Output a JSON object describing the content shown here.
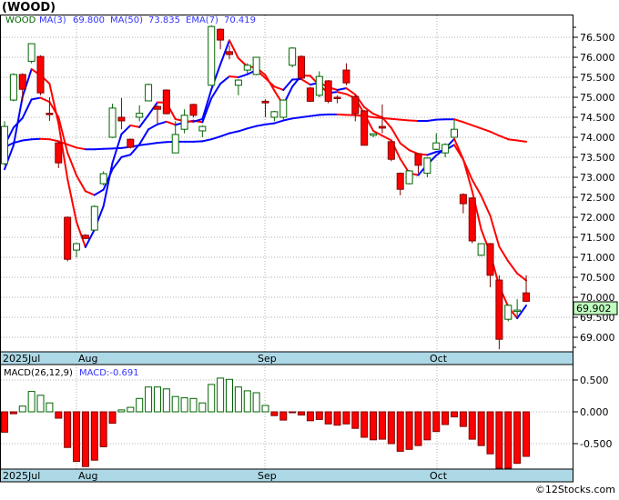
{
  "header": {
    "title": "(WOOD)"
  },
  "legend": {
    "symbol": "WOOD",
    "ma3_label": "MA(3)",
    "ma3_value": "69.800",
    "ma50_label": "MA(50)",
    "ma50_value": "73.835",
    "ema7_label": "EMA(7)",
    "ema7_value": "70.419"
  },
  "macd_legend": {
    "label": "MACD(26,12,9)",
    "value": "MACD:-0.691"
  },
  "last_price": "69.902",
  "footer": "©12Stocks.com",
  "colors": {
    "up": "#006400",
    "down": "#ff0000",
    "rising_line": "#0000ff",
    "falling_line": "#ff0000",
    "axis_strip": "#add8e6",
    "last_price_bg": "#c0ffc0"
  },
  "chart_data": [
    {
      "type": "candlestick",
      "ylim": [
        68.7,
        76.9
      ],
      "y_ticks": [
        "76.500",
        "76.000",
        "75.500",
        "75.000",
        "74.500",
        "74.000",
        "73.500",
        "73.000",
        "72.500",
        "72.000",
        "71.500",
        "71.000",
        "70.500",
        "70.000",
        "69.500",
        "69.000"
      ],
      "x_labels": [
        "2025Jul",
        "Aug",
        "Sep",
        "Oct"
      ],
      "grid": true,
      "ohlc": [
        [
          73.34,
          74.4,
          73.3,
          74.27
        ],
        [
          74.93,
          75.6,
          74.9,
          75.57
        ],
        [
          75.57,
          75.6,
          74.9,
          75.2
        ],
        [
          75.9,
          76.35,
          75.85,
          76.34
        ],
        [
          76.02,
          76.05,
          75.05,
          75.11
        ],
        [
          74.6,
          75.0,
          74.41,
          74.57
        ],
        [
          73.86,
          73.9,
          73.23,
          73.36
        ],
        [
          72.0,
          72.02,
          70.9,
          70.95
        ],
        [
          71.18,
          71.36,
          71.0,
          71.34
        ],
        [
          71.55,
          71.58,
          71.45,
          71.47
        ],
        [
          71.68,
          72.3,
          71.65,
          72.27
        ],
        [
          72.84,
          73.15,
          72.8,
          73.09
        ],
        [
          74.0,
          74.84,
          73.98,
          74.73
        ],
        [
          74.5,
          74.98,
          74.2,
          74.41
        ],
        [
          73.95,
          73.97,
          73.72,
          73.75
        ],
        [
          74.5,
          74.8,
          74.4,
          74.6
        ],
        [
          74.91,
          75.34,
          74.9,
          75.32
        ],
        [
          74.77,
          74.8,
          74.35,
          74.7
        ],
        [
          75.18,
          75.2,
          74.57,
          74.59
        ],
        [
          73.61,
          74.4,
          73.6,
          74.07
        ],
        [
          74.2,
          74.7,
          74.1,
          74.55
        ],
        [
          74.82,
          74.84,
          74.5,
          74.55
        ],
        [
          74.16,
          74.3,
          74.0,
          74.27
        ],
        [
          75.3,
          76.8,
          75.28,
          76.77
        ],
        [
          76.7,
          76.72,
          76.2,
          76.43
        ],
        [
          76.14,
          76.3,
          75.95,
          76.07
        ],
        [
          75.3,
          75.45,
          75.05,
          75.43
        ],
        [
          75.68,
          75.85,
          75.6,
          75.8
        ],
        [
          75.57,
          76.0,
          75.55,
          76.0
        ],
        [
          74.9,
          74.95,
          74.5,
          74.86
        ],
        [
          74.5,
          74.66,
          74.4,
          74.64
        ],
        [
          74.5,
          74.95,
          74.45,
          74.93
        ],
        [
          75.8,
          76.25,
          75.75,
          76.23
        ],
        [
          76.02,
          76.05,
          75.45,
          75.48
        ],
        [
          75.23,
          75.26,
          74.88,
          74.9
        ],
        [
          75.05,
          75.65,
          75.0,
          75.52
        ],
        [
          75.41,
          75.43,
          74.85,
          74.9
        ],
        [
          75.0,
          75.05,
          74.85,
          74.98
        ],
        [
          75.68,
          75.85,
          75.3,
          75.36
        ],
        [
          75.02,
          75.05,
          74.4,
          74.59
        ],
        [
          74.66,
          74.68,
          73.8,
          73.8
        ],
        [
          74.05,
          74.1,
          74.0,
          74.09
        ],
        [
          74.27,
          74.82,
          74.1,
          74.23
        ],
        [
          73.89,
          73.9,
          73.4,
          73.45
        ],
        [
          73.1,
          73.12,
          72.55,
          72.7
        ],
        [
          72.84,
          73.18,
          72.82,
          73.16
        ],
        [
          73.59,
          73.6,
          73.1,
          73.3
        ],
        [
          73.1,
          73.5,
          73.0,
          73.48
        ],
        [
          73.7,
          74.1,
          73.68,
          73.86
        ],
        [
          73.61,
          73.85,
          73.5,
          73.82
        ],
        [
          74.0,
          74.43,
          73.98,
          74.2
        ],
        [
          72.57,
          72.6,
          72.1,
          72.34
        ],
        [
          72.48,
          72.5,
          71.35,
          71.41
        ],
        [
          71.05,
          71.35,
          71.03,
          71.34
        ],
        [
          71.34,
          71.36,
          70.25,
          70.55
        ],
        [
          70.43,
          70.55,
          68.7,
          68.95
        ],
        [
          69.45,
          69.82,
          69.4,
          69.8
        ],
        [
          69.68,
          69.95,
          69.5,
          69.68
        ],
        [
          70.11,
          70.55,
          69.88,
          69.9
        ]
      ],
      "ma50": [
        73.75,
        73.86,
        73.92,
        73.95,
        73.96,
        73.95,
        73.9,
        73.82,
        73.74,
        73.7,
        73.7,
        73.71,
        73.72,
        73.73,
        73.76,
        73.8,
        73.83,
        73.86,
        73.88,
        73.89,
        73.89,
        73.89,
        73.9,
        73.95,
        74.02,
        74.1,
        74.15,
        74.22,
        74.28,
        74.32,
        74.35,
        74.42,
        74.47,
        74.5,
        74.53,
        74.56,
        74.57,
        74.57,
        74.56,
        74.55,
        74.53,
        74.5,
        74.48,
        74.46,
        74.44,
        74.42,
        74.41,
        74.41,
        74.44,
        74.45,
        74.45,
        74.38,
        74.3,
        74.22,
        74.14,
        74.04,
        73.95,
        73.92,
        73.89
      ]
    },
    {
      "type": "bar",
      "title": "MACD(26,12,9)",
      "ylim": [
        -0.89,
        0.7
      ],
      "y_ticks": [
        "0.500",
        "0.000",
        "-0.500"
      ],
      "x_labels": [
        "2025Jul",
        "Aug",
        "Sep",
        "Oct"
      ],
      "values": [
        -0.32,
        -0.03,
        0.09,
        0.32,
        0.26,
        0.14,
        -0.1,
        -0.56,
        -0.78,
        -0.86,
        -0.76,
        -0.55,
        -0.18,
        0.03,
        0.07,
        0.21,
        0.39,
        0.39,
        0.36,
        0.24,
        0.22,
        0.21,
        0.14,
        0.43,
        0.53,
        0.51,
        0.39,
        0.33,
        0.3,
        0.1,
        -0.06,
        -0.13,
        -0.005,
        -0.05,
        -0.14,
        -0.12,
        -0.19,
        -0.21,
        -0.19,
        -0.26,
        -0.4,
        -0.44,
        -0.43,
        -0.5,
        -0.62,
        -0.59,
        -0.53,
        -0.44,
        -0.31,
        -0.2,
        -0.08,
        -0.23,
        -0.43,
        -0.53,
        -0.66,
        -0.9,
        -0.89,
        -0.81,
        -0.7
      ]
    }
  ]
}
